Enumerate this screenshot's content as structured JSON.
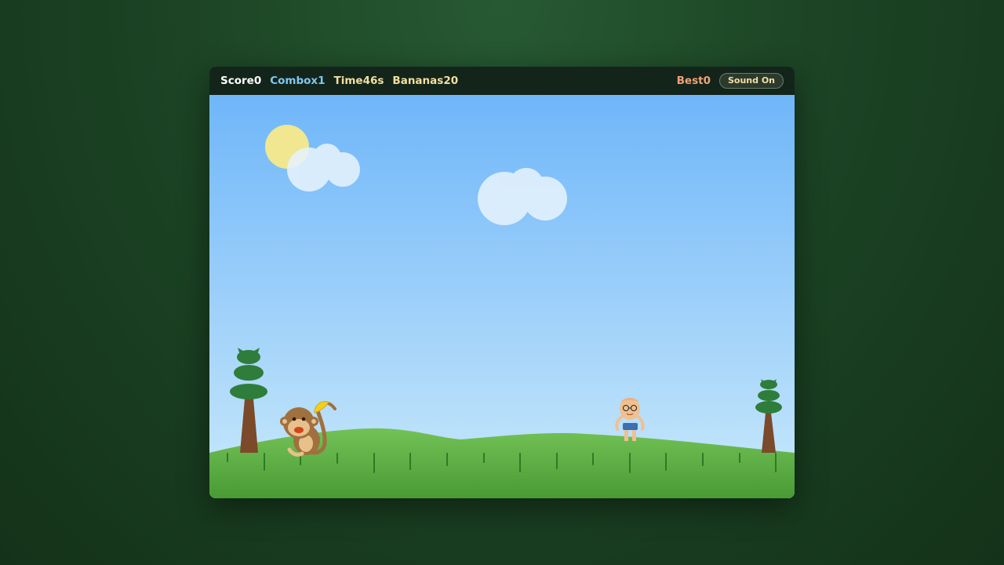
{
  "hud": {
    "score_label": "Score",
    "score_value": "0",
    "combo_label": "Combo",
    "combo_value": "x1",
    "time_label": "Time",
    "time_value": "46s",
    "bananas_label": "Bananas",
    "bananas_value": "20",
    "best_label": "Best",
    "best_value": "0",
    "sound_button_label": "Sound On"
  },
  "colors": {
    "hud_background": "#13251a",
    "score": "#ffffff",
    "combo": "#7ec8f2",
    "time": "#f4dfa0",
    "bananas": "#f4dfa0",
    "best": "#f2a27a",
    "sky_top": "#6fb6f9",
    "sky_bottom": "#c9e9fb",
    "grass": "#5aa63f"
  },
  "scene": {
    "sprites": [
      "sun",
      "cloud",
      "cloud",
      "palm-tree",
      "palm-tree",
      "monkey-with-banana",
      "kid-player"
    ]
  }
}
